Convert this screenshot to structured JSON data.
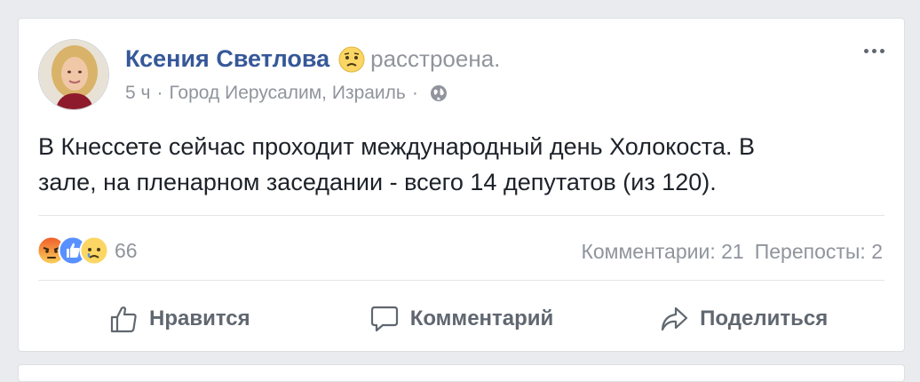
{
  "post": {
    "author_name": "Ксения Светлова",
    "feeling_icon": "sad-face-icon",
    "feeling_text": "расстроена.",
    "time": "5 ч",
    "separator": "·",
    "location": "Город Иерусалим, Израиль",
    "privacy_icon": "globe-icon",
    "text_line1": "В Кнессете сейчас проходит международный день Холокоста. В",
    "text_line2": "зале, на пленарном заседании - всего 14 депутатов (из 120)."
  },
  "reactions": {
    "icons": [
      "angry-icon",
      "like-icon",
      "sad-icon"
    ],
    "count": "66"
  },
  "stats": {
    "comments": "Комментарии: 21",
    "shares": "Перепосты: 2"
  },
  "actions": {
    "like": "Нравится",
    "comment": "Комментарий",
    "share": "Поделиться"
  },
  "colors": {
    "name": "#365899",
    "meta": "#90949c",
    "text": "#1d2129",
    "action": "#606770",
    "like_blue": "#5890ff",
    "angry_orange": "#f05a28",
    "sad_yellow": "#fcd664"
  }
}
